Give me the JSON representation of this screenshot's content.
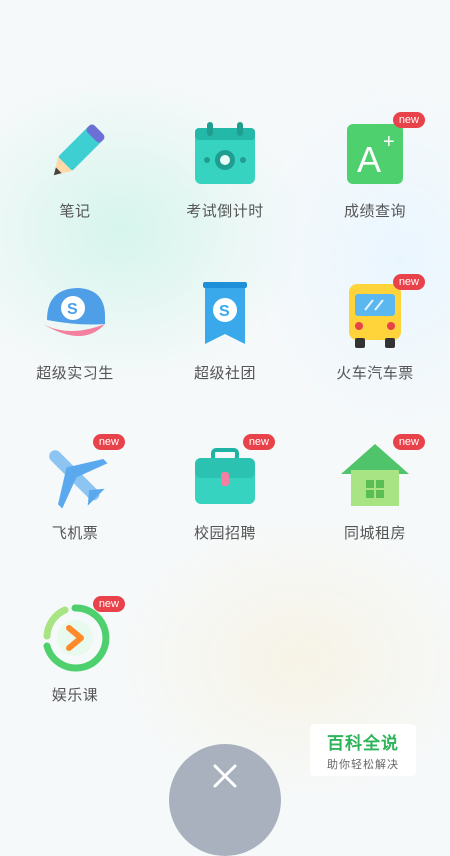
{
  "items": [
    {
      "label": "笔记",
      "badge": ""
    },
    {
      "label": "考试倒计时",
      "badge": ""
    },
    {
      "label": "成绩查询",
      "badge": "new"
    },
    {
      "label": "超级实习生",
      "badge": ""
    },
    {
      "label": "超级社团",
      "badge": ""
    },
    {
      "label": "火车汽车票",
      "badge": "new"
    },
    {
      "label": "飞机票",
      "badge": "new"
    },
    {
      "label": "校园招聘",
      "badge": "new"
    },
    {
      "label": "同城租房",
      "badge": "new"
    },
    {
      "label": "娱乐课",
      "badge": "new"
    }
  ],
  "icons": {
    "i0": "pencil-icon",
    "i1": "calendar-icon",
    "i2": "grade-a-plus-icon",
    "i3": "cap-icon",
    "i4": "club-banner-icon",
    "i5": "bus-icon",
    "i6": "airplane-icon",
    "i7": "briefcase-icon",
    "i8": "house-icon",
    "i9": "play-icon",
    "close": "close-icon"
  },
  "watermark": {
    "title": "百科全说",
    "subtitle": "助你轻松解决"
  },
  "colors": {
    "badge": "#e8434a",
    "teal": "#36d3c0",
    "green": "#4fd06e",
    "yellow": "#ffd43b",
    "blue": "#5aa9ef",
    "close_bg": "#a9b1be"
  }
}
